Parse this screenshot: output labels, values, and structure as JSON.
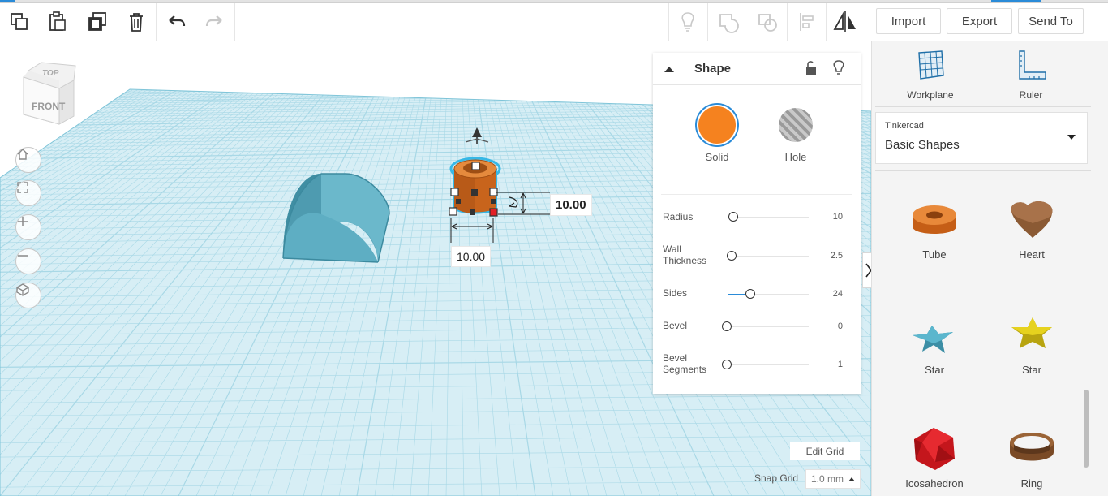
{
  "toolbar": {
    "tools": [
      {
        "name": "copy-icon",
        "label": "Copy"
      },
      {
        "name": "paste-icon",
        "label": "Paste"
      },
      {
        "name": "duplicate-icon",
        "label": "Duplicate"
      },
      {
        "name": "delete-icon",
        "label": "Delete"
      },
      {
        "name": "undo-icon",
        "label": "Undo"
      },
      {
        "name": "redo-icon",
        "label": "Redo"
      }
    ],
    "view_tools": [
      "lightbulb-icon",
      "group-icon",
      "ungroup-icon",
      "align-icon",
      "mirror-icon"
    ]
  },
  "header": {
    "import_label": "Import",
    "export_label": "Export",
    "send_to_label": "Send To"
  },
  "viewcube": {
    "top_label": "TOP",
    "front_label": "FRONT"
  },
  "dimensions": {
    "height_value": "10.00",
    "width_value": "10.00"
  },
  "inspector": {
    "title": "Shape",
    "solid_label": "Solid",
    "hole_label": "Hole",
    "solid_color": "#f5821f",
    "params": [
      {
        "label": "Radius",
        "value": "10",
        "level": 0.07
      },
      {
        "label": "Wall Thickness",
        "value": "2.5",
        "level": 0.04
      },
      {
        "label": "Sides",
        "value": "24",
        "level": 0.28
      },
      {
        "label": "Bevel",
        "value": "0",
        "level": 0.0
      },
      {
        "label": "Bevel Segments",
        "value": "1",
        "level": 0.0
      }
    ]
  },
  "grid": {
    "edit_grid_label": "Edit Grid",
    "snap_grid_label": "Snap Grid",
    "snap_grid_value": "1.0 mm"
  },
  "right_panel": {
    "workplane_label": "Workplane",
    "ruler_label": "Ruler",
    "library_category": "Tinkercad",
    "library_name": "Basic Shapes",
    "shapes": [
      "Tube",
      "Heart",
      "Star",
      "Star",
      "Icosahedron",
      "Ring"
    ]
  },
  "colors": {
    "grid": "#a8d8e6",
    "accent": "#2a8bd8",
    "tube": "#d46b1e",
    "halfcyl": "#5aa8bc"
  }
}
